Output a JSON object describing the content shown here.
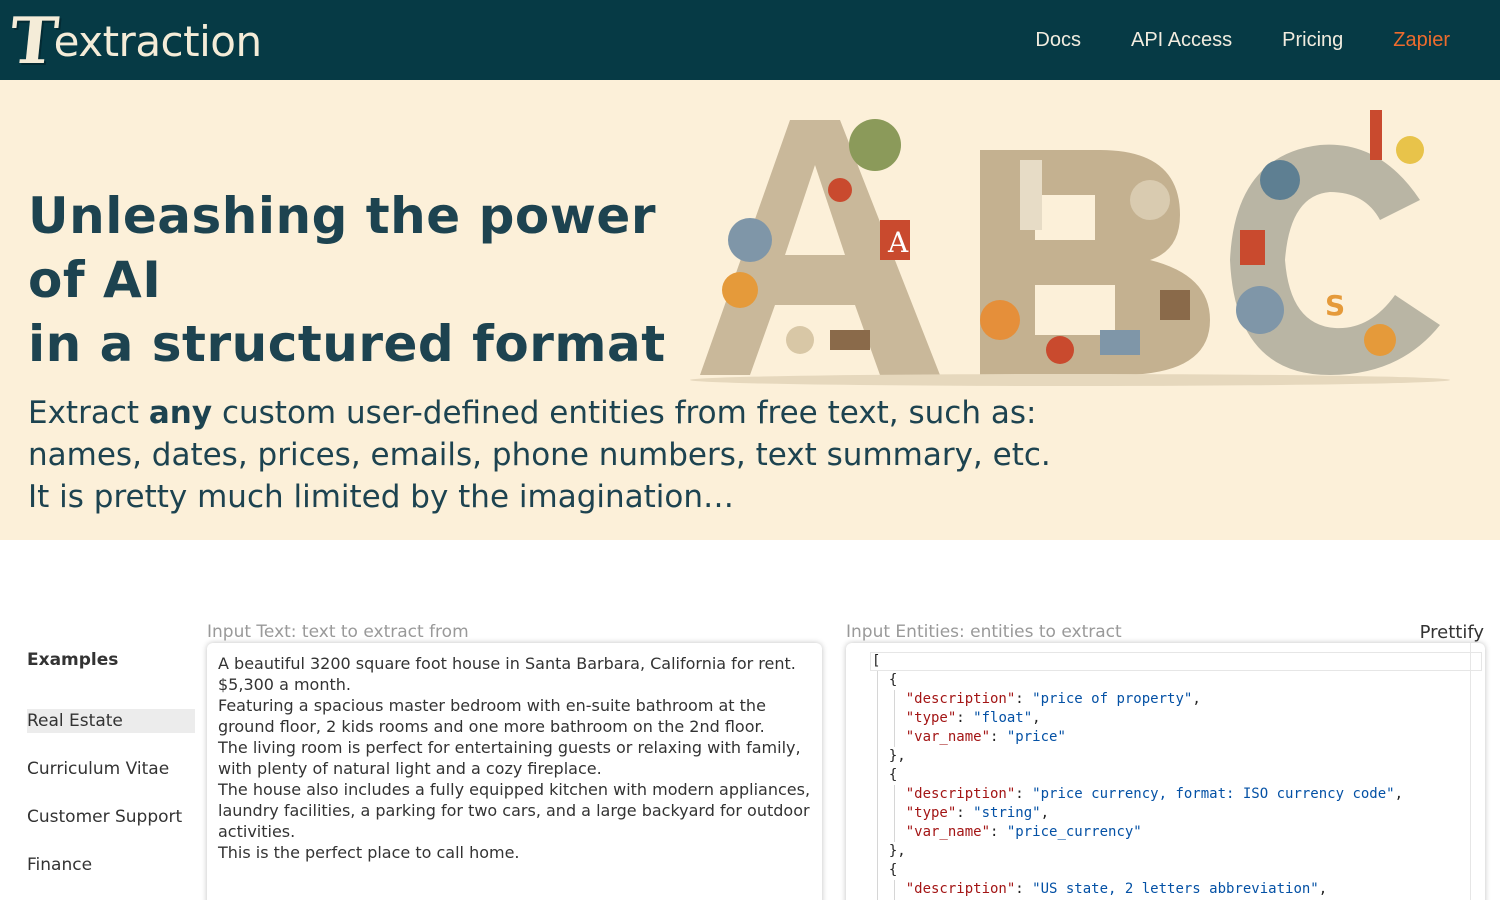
{
  "header": {
    "logo_initial": "T",
    "logo_rest": "extraction",
    "nav": [
      {
        "label": "Docs"
      },
      {
        "label": "API Access"
      },
      {
        "label": "Pricing"
      },
      {
        "label": "Zapier"
      }
    ]
  },
  "hero": {
    "title_line1": "Unleashing the power of AI",
    "title_line2": "in a structured format",
    "sub_pre": "Extract ",
    "sub_bold": "any",
    "sub_post": " custom user-defined entities from free text, such as:",
    "sub_line2": "names, dates, prices, emails, phone numbers, text summary, etc.",
    "sub_line3": "It is pretty much limited by the imagination…"
  },
  "examples": {
    "title": "Examples",
    "items": [
      {
        "label": "Real Estate"
      },
      {
        "label": "Curriculum Vitae"
      },
      {
        "label": "Customer Support"
      },
      {
        "label": "Finance"
      }
    ]
  },
  "input_text": {
    "label": "Input Text: text to extract from",
    "lines": [
      "A beautiful 3200 square foot house in Santa Barbara, California for rent. $5,300 a month.",
      "Featuring a spacious master bedroom with en-suite bathroom at the ground floor, 2 kids rooms and one more bathroom on the 2nd floor.",
      "The living room is perfect for entertaining guests or relaxing with family, with plenty of natural light and a cozy fireplace.",
      "The house also includes a fully equipped kitchen with modern appliances, laundry facilities, a parking for two cars, and a large backyard for outdoor activities.",
      "This is the perfect place to call home."
    ]
  },
  "input_entities": {
    "label": "Input Entities: entities to extract",
    "prettify_label": "Prettify",
    "entities": [
      {
        "description": "price of property",
        "type": "float",
        "var_name": "price"
      },
      {
        "description": "price currency, format: ISO currency code",
        "type": "string",
        "var_name": "price_currency"
      },
      {
        "description": "US state, 2 letters abbreviation"
      }
    ],
    "keys": {
      "description": "\"description\"",
      "type": "\"type\"",
      "var_name": "\"var_name\""
    }
  },
  "colors": {
    "header_bg": "#063a45",
    "hero_bg": "#fcf0d9",
    "accent": "#ee6b2d",
    "title_text": "#1d4350"
  }
}
